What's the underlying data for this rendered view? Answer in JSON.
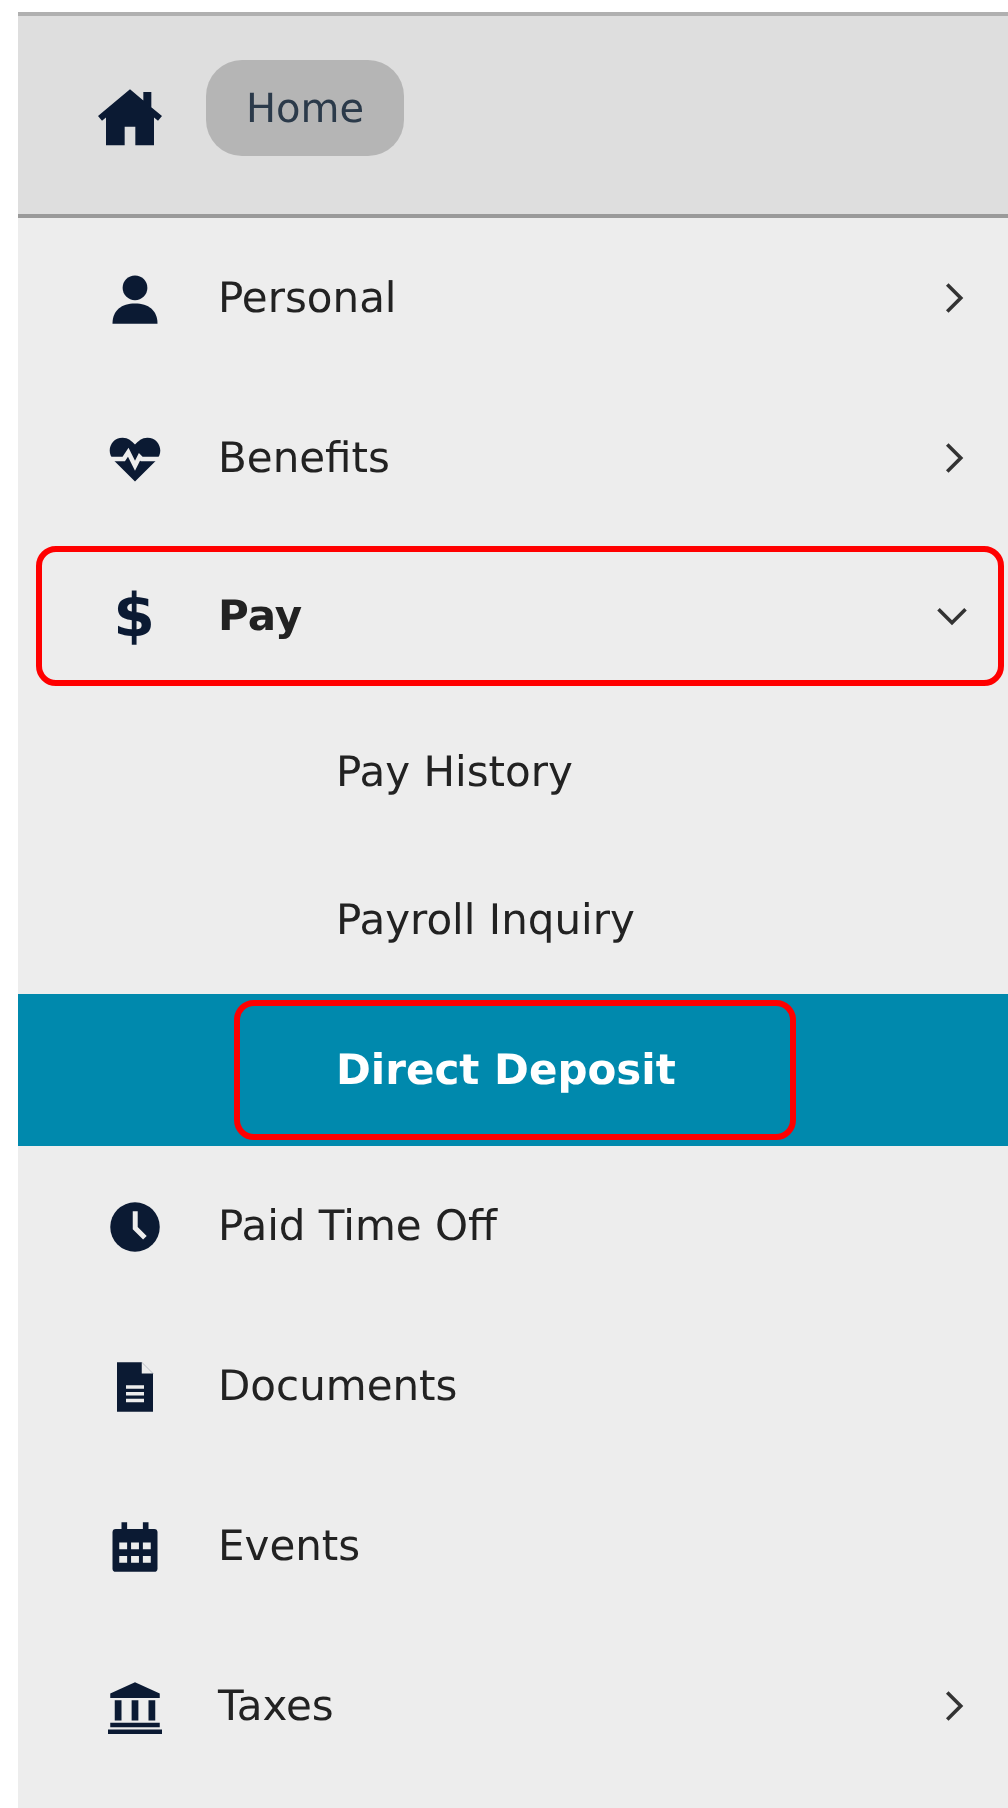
{
  "header": {
    "home_label": "Home"
  },
  "nav": [
    {
      "label": "Personal",
      "expanded": false,
      "highlighted": false
    },
    {
      "label": "Benefits",
      "expanded": false,
      "highlighted": false
    },
    {
      "label": "Pay",
      "glyph": "$",
      "expanded": true,
      "highlighted": true,
      "children": [
        {
          "label": "Pay History",
          "selected": false,
          "highlighted": false
        },
        {
          "label": "Payroll Inquiry",
          "selected": false,
          "highlighted": false
        },
        {
          "label": "Direct Deposit",
          "selected": true,
          "highlighted": true
        }
      ]
    },
    {
      "label": "Paid Time Off",
      "highlighted": false
    },
    {
      "label": "Documents",
      "highlighted": false
    },
    {
      "label": "Events",
      "highlighted": false
    },
    {
      "label": "Taxes",
      "expanded": false,
      "highlighted": false
    }
  ]
}
